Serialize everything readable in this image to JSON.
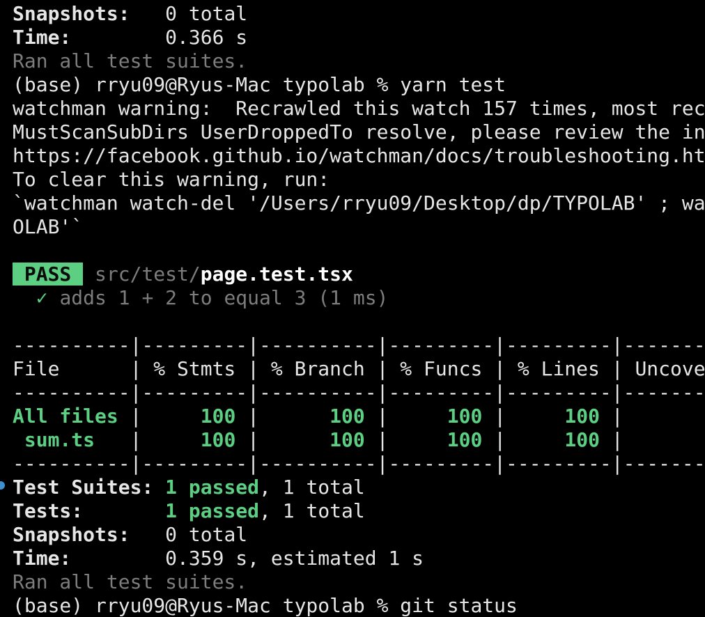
{
  "terminal": {
    "top_summary": {
      "snapshots_label": "Snapshots:",
      "snapshots_value": "0 total",
      "time_label": "Time:",
      "time_value": "0.366 s",
      "ran_all": "Ran all test suites."
    },
    "prompt1": "(base) rryu09@Ryus-Mac typolab % yarn test",
    "warning_lines": [
      "watchman warning:  Recrawled this watch 157 times, most rec",
      "MustScanSubDirs UserDroppedTo resolve, please review the in",
      "https://facebook.github.io/watchman/docs/troubleshooting.ht",
      "To clear this warning, run:",
      "`watchman watch-del '/Users/rryu09/Desktop/dp/TYPOLAB' ; wa",
      "OLAB'`"
    ],
    "pass_result": {
      "badge": "PASS",
      "path_dir": "src/test/",
      "path_file": "page.test.tsx",
      "check_mark": "✓",
      "test_name": "adds 1 + 2 to equal 3 (1 ms)"
    },
    "coverage": {
      "separator": "----------|---------|----------|---------|---------|-------",
      "header": "File      | % Stmts | % Branch | % Funcs | % Lines | Uncove",
      "rows": [
        {
          "file": "All files",
          "stmts": "100",
          "branch": "100",
          "funcs": "100",
          "lines": "100"
        },
        {
          "file": " sum.ts",
          "stmts": "100",
          "branch": "100",
          "funcs": "100",
          "lines": "100"
        }
      ]
    },
    "bottom_summary": {
      "suites_label": "Test Suites:",
      "suites_passed": "1 passed",
      "suites_total": ", 1 total",
      "tests_label": "Tests:",
      "tests_passed": "1 passed",
      "tests_total": ", 1 total",
      "snapshots_label": "Snapshots:",
      "snapshots_value": "0 total",
      "time_label": "Time:",
      "time_value": "0.359 s, estimated 1 s",
      "ran_all": "Ran all test suites."
    },
    "prompt2": "(base) rryu09@Ryus-Mac typolab % git status",
    "colors": {
      "background": "#000000",
      "text": "#e6e6e6",
      "dim": "#7d7d7d",
      "pass_green": "#5ccf83",
      "marker_blue": "#3d8fcf"
    }
  }
}
